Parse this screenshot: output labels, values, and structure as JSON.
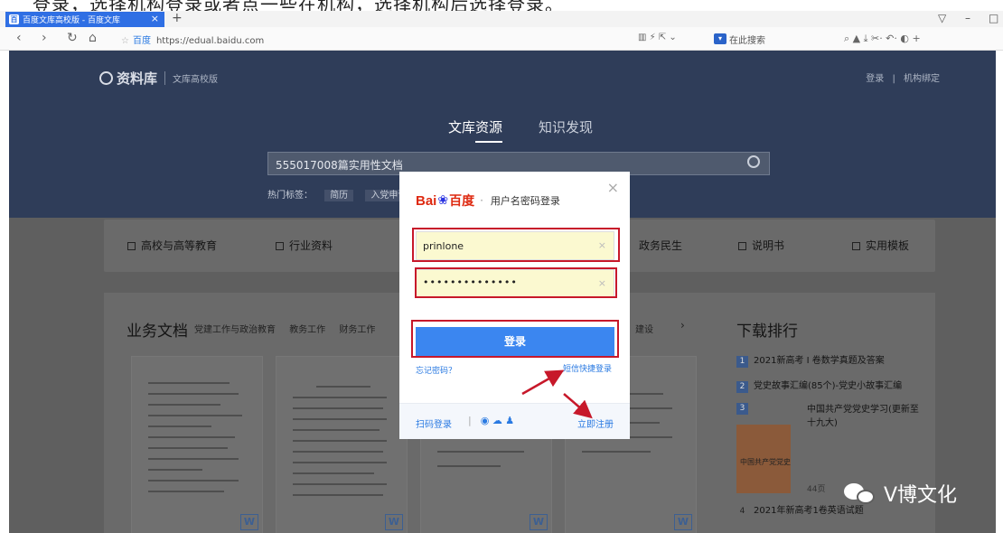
{
  "caption": "登录，选择机构登录或者点一些在机构，选择机构后选择登录。",
  "browser": {
    "tab_title": "百度文库高校版 - 百度文库",
    "favicon": "百",
    "newtab": "+",
    "tab_close": "×",
    "window_controls": [
      "▽",
      "–",
      "□"
    ],
    "nav": [
      "‹",
      "›",
      "↻",
      "⌂"
    ],
    "site_label": "百度",
    "url": "https://edual.baidu.com",
    "toolbar_icons": "▥  ⚡  ⇱  ⌄",
    "search_placeholder": "在此搜索",
    "right_tools": "⌕  ▲  ⤓  ✂·  ↶·  ◐  +"
  },
  "header": {
    "logo_text": "资料库",
    "logo_sub": "文库高校版",
    "login_link": "登录",
    "separator": "|",
    "bind_link": "机构绑定"
  },
  "hero": {
    "tabs": [
      "文库资源",
      "知识发现"
    ],
    "search_value": "555017008篇实用性文档",
    "hot_label": "热门标签：",
    "hot_words": [
      "简历",
      "入党申请"
    ]
  },
  "categories": [
    "高校与高等教育",
    "行业资料",
    "政务民生",
    "说明书",
    "实用模板"
  ],
  "section": {
    "title": "业务文档",
    "tabs": [
      "党建工作与政治教育",
      "教务工作",
      "财务工作"
    ],
    "more": "建设",
    "arrow": "›",
    "doc_badge": "W"
  },
  "ranking": {
    "title": "下载排行",
    "items": [
      {
        "num": "1",
        "text": "2021新高考 I 卷数学真题及答案"
      },
      {
        "num": "2",
        "text": "党史故事汇编(85个)-党史小故事汇编"
      },
      {
        "num": "3",
        "text": "中国共产党党史学习(更新至十九大)"
      },
      {
        "num": "4",
        "text": "2021年新高考1卷英语试题"
      }
    ],
    "pages": "44页",
    "book_text": "中国共产党党史"
  },
  "login_modal": {
    "brand_bai": "Bai",
    "brand_paw": "❀",
    "brand_du": "百度",
    "dot": "·",
    "title": "用户名密码登录",
    "close": "×",
    "username": "prinlone",
    "password": "••••••••••••••",
    "clear": "×",
    "submit": "登录",
    "forgot": "忘记密码？",
    "sms_login": "短信快捷登录",
    "qr_login": "扫码登录",
    "social_sep": "|",
    "social_icons": "◉ ☁ ♟",
    "register": "立即注册"
  },
  "watermark": {
    "text": "V博文化"
  },
  "annotation_color": "#c7182a",
  "accent_color": "#3b86f0"
}
